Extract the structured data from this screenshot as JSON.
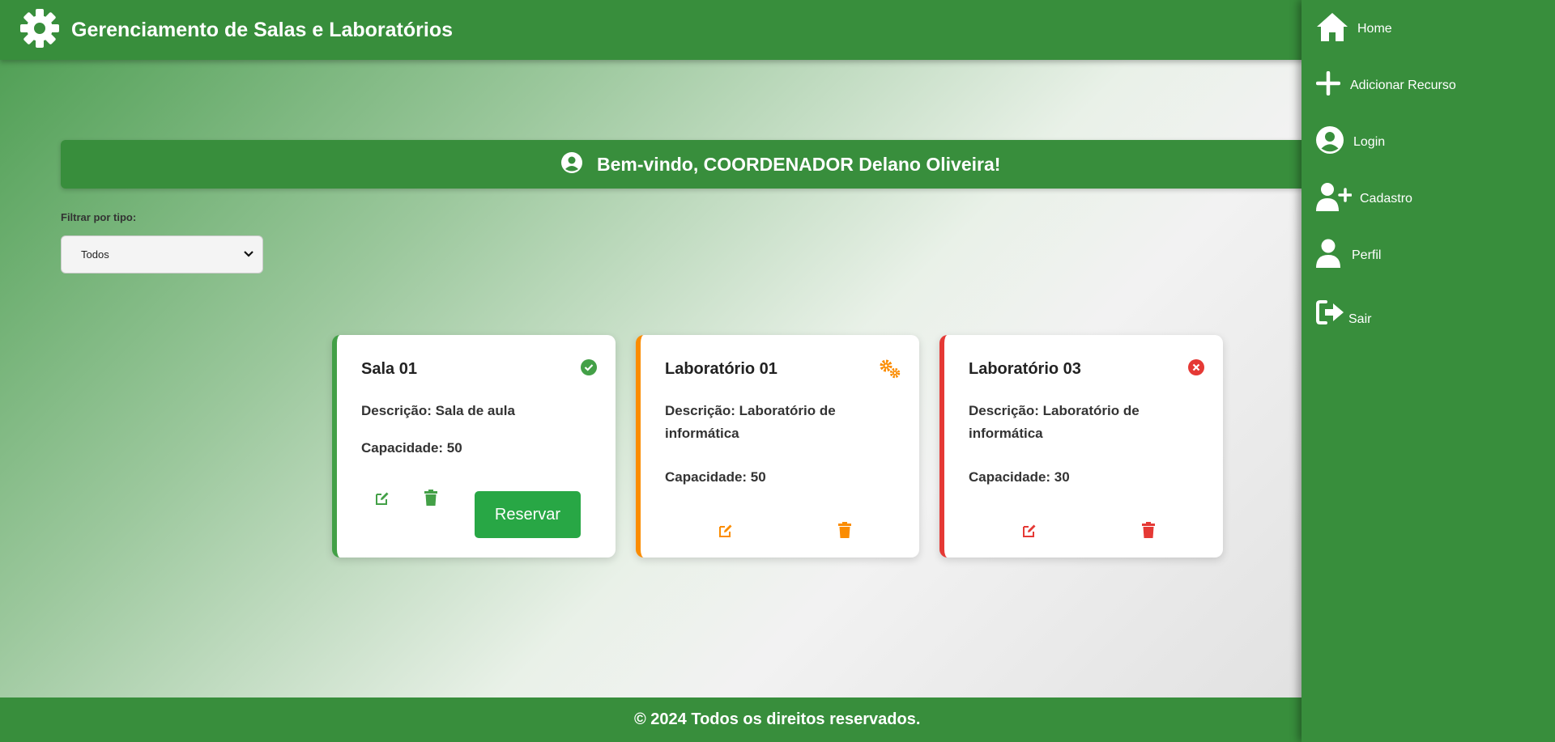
{
  "header": {
    "title": "Gerenciamento de Salas e Laboratórios"
  },
  "welcome": {
    "text": "Bem-vindo, COORDENADOR Delano Oliveira!"
  },
  "filter": {
    "label": "Filtrar por tipo:",
    "selected": "Todos"
  },
  "cards": [
    {
      "title": "Sala 01",
      "description": "Descrição: Sala de aula",
      "capacity": "Capacidade: 50",
      "status": "available",
      "accent": "#43a047",
      "reserve_label": "Reservar"
    },
    {
      "title": "Laboratório 01",
      "description": "Descrição: Laboratório de informática",
      "capacity": "Capacidade: 50",
      "status": "maintenance",
      "accent": "#fb8c00"
    },
    {
      "title": "Laboratório 03",
      "description": "Descrição: Laboratório de informática",
      "capacity": "Capacidade: 30",
      "status": "unavailable",
      "accent": "#e53935"
    }
  ],
  "sidebar": {
    "items": [
      {
        "label": "Home",
        "icon": "home-icon"
      },
      {
        "label": "Adicionar Recurso",
        "icon": "plus-icon"
      },
      {
        "label": "Login",
        "icon": "user-circle-icon"
      },
      {
        "label": "Cadastro",
        "icon": "user-plus-icon"
      },
      {
        "label": "Perfil",
        "icon": "user-icon"
      },
      {
        "label": "Sair",
        "icon": "sign-out-icon"
      }
    ]
  },
  "footer": {
    "text": "© 2024 Todos os direitos reservados."
  },
  "colors": {
    "primary": "#388e3c",
    "success": "#43a047",
    "warning": "#fb8c00",
    "danger": "#e53935",
    "reserve": "#28a745"
  }
}
